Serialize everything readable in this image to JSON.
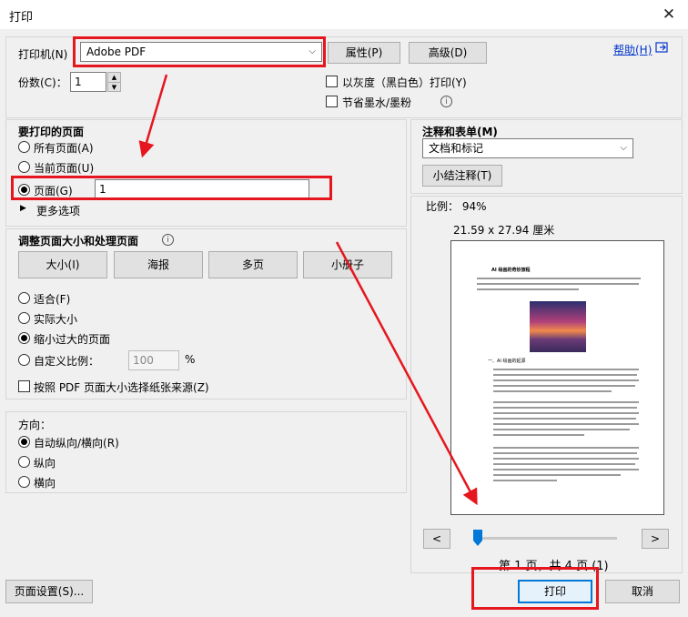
{
  "window": {
    "title": "打印",
    "close_glyph": "✕"
  },
  "printer": {
    "label": "打印机(N)",
    "selected": "Adobe PDF",
    "properties_button": "属性(P)",
    "advanced_button": "高级(D)",
    "help_link": "帮助(H)",
    "copies_label": "份数(C)：",
    "copies_value": "1",
    "grayscale_label": "以灰度（黑白色）打印(Y)",
    "save_ink_label": "节省墨水/墨粉"
  },
  "pages_to_print": {
    "heading": "要打印的页面",
    "all_pages": "所有页面(A)",
    "current_page": "当前页面(U)",
    "pages": "页面(G)",
    "pages_value": "1",
    "more_options": "更多选项"
  },
  "sizing": {
    "heading": "调整页面大小和处理页面",
    "tabs": [
      "大小(I)",
      "海报",
      "多页",
      "小册子"
    ],
    "fit": "适合(F)",
    "actual_size": "实际大小",
    "shrink": "缩小过大的页面",
    "custom_scale": "自定义比例：",
    "custom_scale_value": "100",
    "percent": "%",
    "choose_paper_source": "按照 PDF 页面大小选择纸张来源(Z)"
  },
  "orientation": {
    "heading": "方向：",
    "auto": "自动纵向/横向(R)",
    "portrait": "纵向",
    "landscape": "横向"
  },
  "comments": {
    "heading": "注释和表单(M)",
    "selected": "文档和标记",
    "summarize_button": "小结注释(T)"
  },
  "preview": {
    "scale": "比例： 94%",
    "dimensions": "21.59 x 27.94 厘米",
    "page_info": "第 1 页，共 4 页 (1)",
    "prev": "<",
    "next": ">",
    "doc_title": "AI 绘画的奇妙旅程",
    "section": "一、AI 绘画的起源"
  },
  "footer": {
    "page_setup_button": "页面设置(S)...",
    "print_button": "打印",
    "cancel_button": "取消"
  },
  "colors": {
    "annotation": "#e5161e",
    "accent": "#0078d7",
    "link": "#0033cc"
  }
}
